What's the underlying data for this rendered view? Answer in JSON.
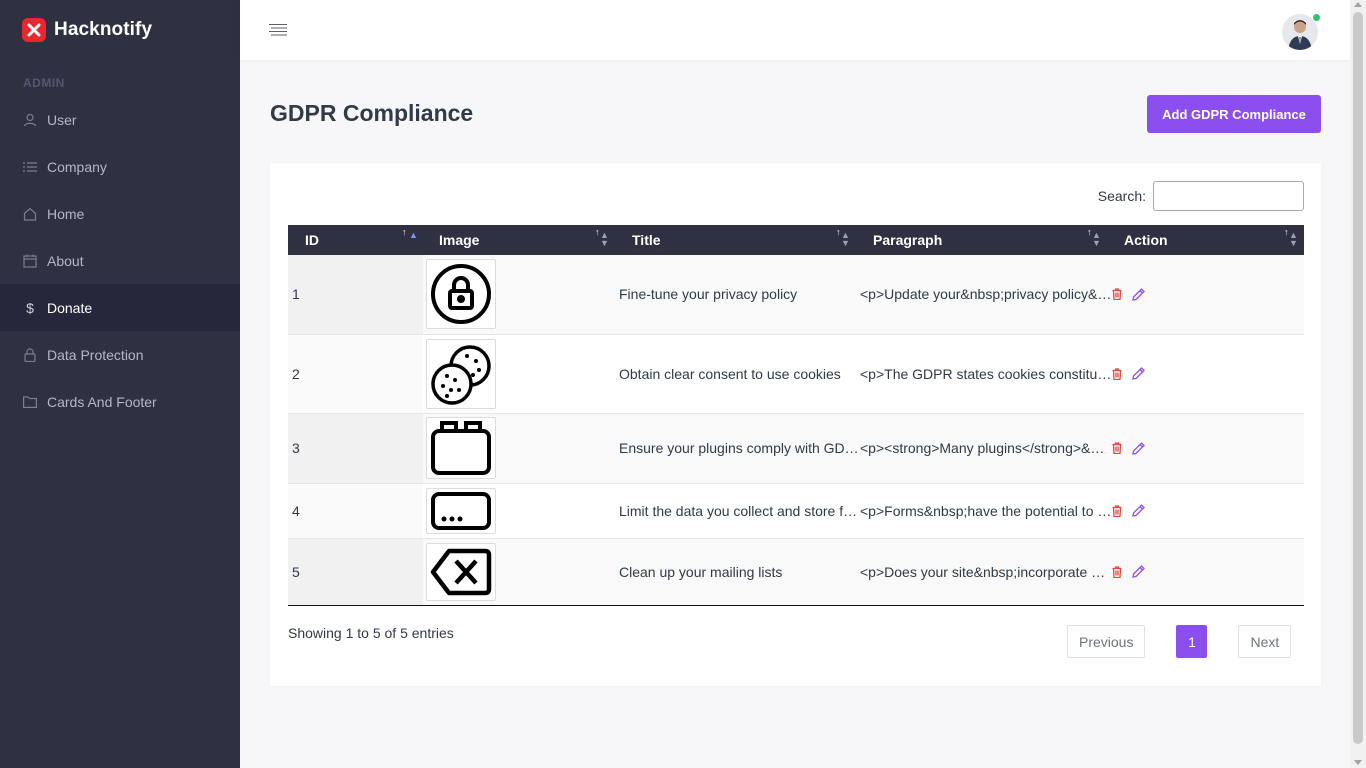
{
  "brand": {
    "name": "Hacknotify"
  },
  "sidebar": {
    "section_label": "ADMIN",
    "items": [
      {
        "label": "User",
        "icon": "user-icon",
        "active": false
      },
      {
        "label": "Company",
        "icon": "list-icon",
        "active": false
      },
      {
        "label": "Home",
        "icon": "home-icon",
        "active": false
      },
      {
        "label": "About",
        "icon": "calendar-icon",
        "active": false
      },
      {
        "label": "Donate",
        "icon": "dollar-icon",
        "active": true
      },
      {
        "label": "Data Protection",
        "icon": "lock-icon",
        "active": false
      },
      {
        "label": "Cards And Footer",
        "icon": "folder-icon",
        "active": false
      }
    ]
  },
  "header": {
    "menu_icon": "menu-icon",
    "avatar": "user-avatar",
    "status": "online"
  },
  "page": {
    "title": "GDPR Compliance",
    "add_button_label": "Add GDPR Compliance"
  },
  "search": {
    "label": "Search:",
    "value": ""
  },
  "table": {
    "columns": [
      "ID",
      "Image",
      "Title",
      "Paragraph",
      "Action"
    ],
    "rows": [
      {
        "id": "1",
        "image": "padlock-icon",
        "title": "Fine-tune your privacy policy",
        "paragraph": "<p>Update your&nbsp;privacy policy&nbsp;to reflect how you collect data"
      },
      {
        "id": "2",
        "image": "cookies-icon",
        "title": "Obtain clear consent to use cookies",
        "paragraph": "<p>The GDPR states cookies constitute personal data"
      },
      {
        "id": "3",
        "image": "plugin-icon",
        "title": "Ensure your plugins comply with GDPR",
        "paragraph": "<p><strong>Many plugins</strong>&nbsp;collect data"
      },
      {
        "id": "4",
        "image": "form-icon",
        "title": "Limit the data you collect and store from forms",
        "paragraph": "<p>Forms&nbsp;have the potential to collect data"
      },
      {
        "id": "5",
        "image": "delete-key-icon",
        "title": "Clean up your mailing lists",
        "paragraph": "<p>Does your site&nbsp;incorporate a mailing list"
      }
    ]
  },
  "footer": {
    "info": "Showing 1 to 5 of 5 entries",
    "previous": "Previous",
    "page": "1",
    "next": "Next"
  },
  "colors": {
    "accent": "#8b4ff0",
    "sidebar": "#2f3042",
    "brand_red": "#e8282e",
    "trash": "#e0473f"
  }
}
